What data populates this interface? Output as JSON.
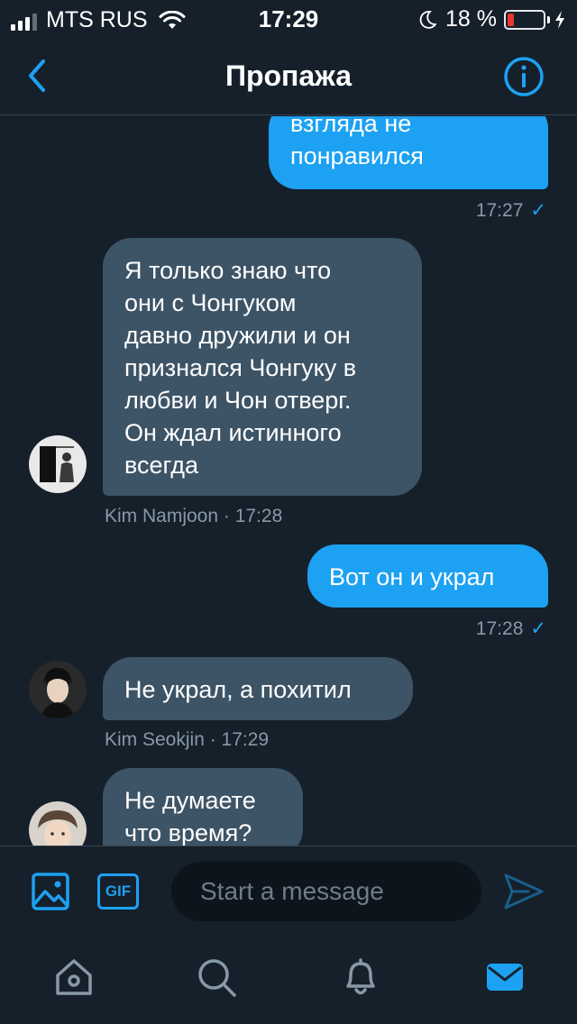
{
  "status_bar": {
    "carrier": "MTS RUS",
    "time": "17:29",
    "battery_percent": "18 %",
    "battery_level": 0.18,
    "battery_color": "#ff3b30",
    "icons": [
      "signal-icon",
      "wifi-icon",
      "moon-icon",
      "battery-icon",
      "charging-bolt-icon"
    ]
  },
  "header": {
    "title": "Пропажа",
    "back_icon": "chevron-left-icon",
    "info_icon": "info-icon"
  },
  "messages": [
    {
      "direction": "outgoing",
      "lines": [
        "взгляда не",
        "понравился"
      ],
      "time": "17:27",
      "status_icon": "check-icon"
    },
    {
      "direction": "incoming",
      "sender": "Kim Namjoon",
      "lines": [
        "Я только знаю что",
        "они с Чонгуком",
        "давно дружили и он",
        "признался Чонгуку в",
        "любви и Чон отверг.",
        "Он ждал истинного",
        "всегда"
      ],
      "meta": "Kim Namjoon · 17:28"
    },
    {
      "direction": "outgoing",
      "lines": [
        "Вот он и украл"
      ],
      "time": "17:28",
      "status_icon": "check-icon"
    },
    {
      "direction": "incoming",
      "sender": "Kim Seokjin",
      "lines": [
        "Не украл, а похитил"
      ],
      "meta": "Kim Seokjin · 17:29"
    },
    {
      "direction": "incoming",
      "lines": [
        "Не думаете",
        "что время?"
      ]
    }
  ],
  "composer": {
    "media_icon": "image-icon",
    "gif_label": "GIF",
    "placeholder": "Start a message",
    "value": "",
    "send_icon": "send-icon"
  },
  "tabbar": {
    "items": [
      {
        "name": "home",
        "icon": "home-icon",
        "active": false
      },
      {
        "name": "search",
        "icon": "search-icon",
        "active": false
      },
      {
        "name": "notifications",
        "icon": "bell-icon",
        "active": false
      },
      {
        "name": "messages",
        "icon": "mail-icon",
        "active": true
      }
    ]
  },
  "colors": {
    "background": "#15202b",
    "accent": "#1da1f2",
    "incoming_bubble": "#3d5466",
    "meta_text": "#8899a6",
    "divider": "#38444d"
  }
}
